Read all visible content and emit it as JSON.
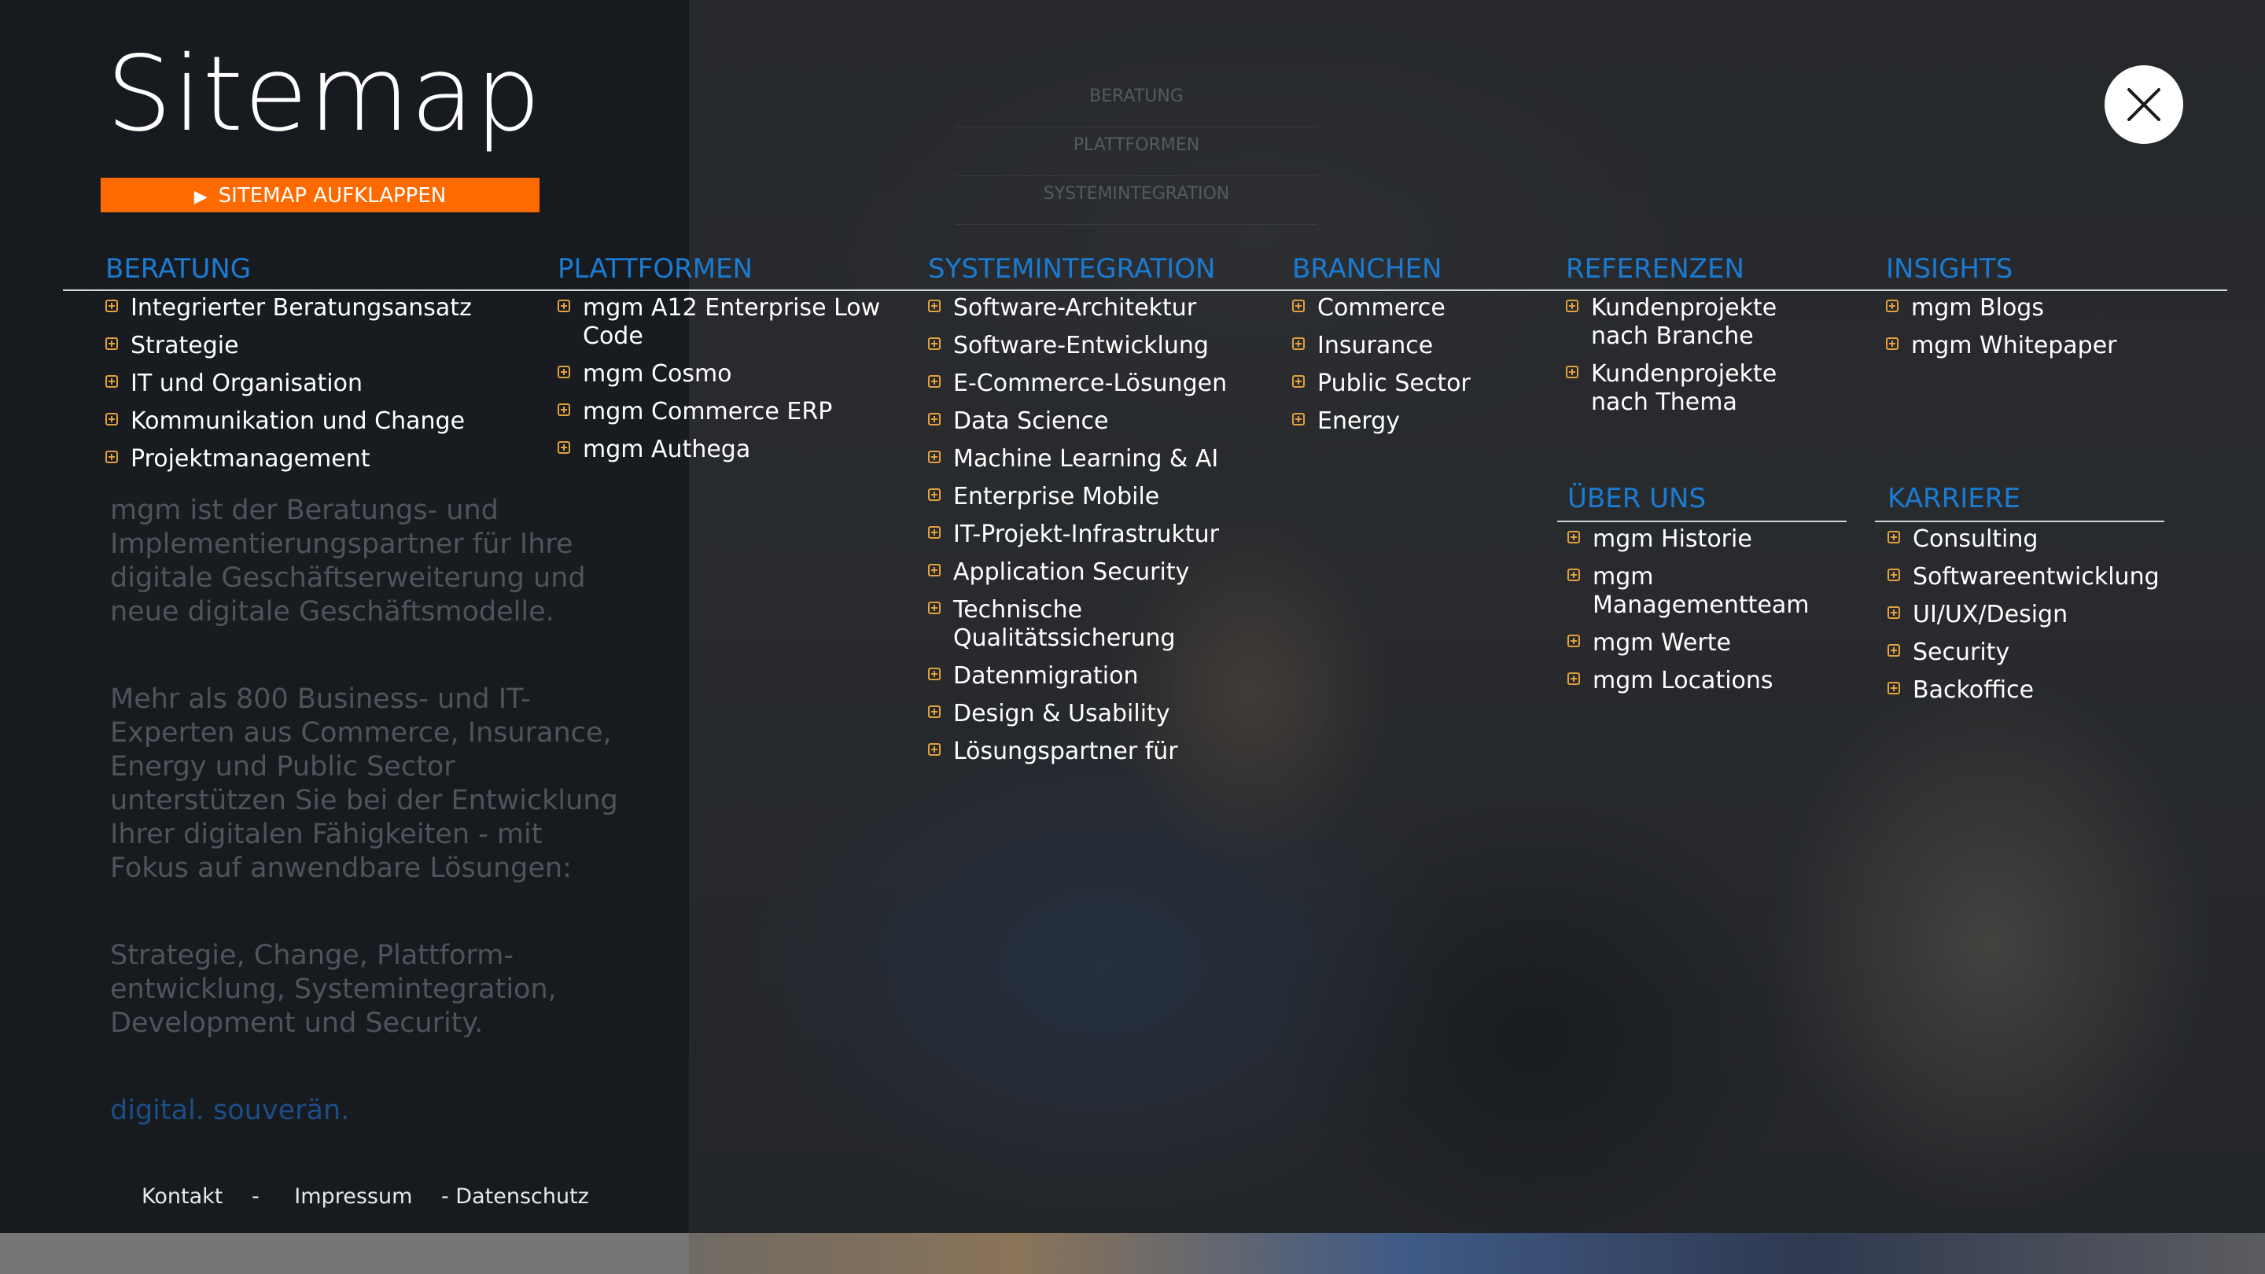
{
  "page": {
    "title": "Sitemap",
    "expand_label": "SITEMAP AUFKLAPPEN",
    "expand_icon": "play-triangle-icon",
    "accent_color": "#ff6a00",
    "heading_color": "#1b7bd1"
  },
  "ghost_nav": [
    "BERATUNG",
    "PLATTFORMEN",
    "SYSTEMINTEGRATION"
  ],
  "columns": {
    "beratung": {
      "title": "BERATUNG",
      "items": [
        "Integrierter Beratungsansatz",
        "Strategie",
        "IT und Organisation",
        "Kommunikation und Change",
        "Projektmanagement"
      ]
    },
    "plattformen": {
      "title": "PLATTFORMEN",
      "items": [
        "mgm A12 Enterprise Low Code",
        "mgm Cosmo",
        "mgm Commerce ERP",
        "mgm Authega"
      ]
    },
    "systemintegration": {
      "title": "SYSTEMINTEGRATION",
      "items": [
        "Software-Architektur",
        "Software-Entwicklung",
        "E-Commerce-Lösungen",
        "Data Science",
        "Machine Learning & AI",
        "Enterprise Mobile",
        "IT-Projekt-Infrastruktur",
        "Application Security",
        "Technische Qualitätssicherung",
        "Datenmigration",
        "Design & Usability",
        "Lösungspartner für"
      ]
    },
    "branchen": {
      "title": "BRANCHEN",
      "items": [
        "Commerce",
        "Insurance",
        "Public Sector",
        "Energy"
      ]
    },
    "referenzen": {
      "title": "REFERENZEN",
      "items": [
        "Kundenprojekte nach Branche",
        "Kundenprojekte nach Thema"
      ]
    },
    "insights": {
      "title": "INSIGHTS",
      "items": [
        "mgm Blogs",
        "mgm Whitepaper"
      ]
    },
    "ueber_uns": {
      "title": "ÜBER UNS",
      "items": [
        "mgm Historie",
        "mgm Managementteam",
        "mgm Werte",
        "mgm Locations"
      ]
    },
    "karriere": {
      "title": "KARRIERE",
      "items": [
        "Consulting",
        "Softwareentwicklung",
        "UI/UX/Design",
        "Security",
        "Backoffice"
      ]
    }
  },
  "intro": {
    "p1": "mgm ist der Beratungs- und Implementierungspartner für Ihre digitale Geschäftserweiterung und neue digitale Geschäftsmodelle.",
    "p2": "Mehr als 800 Business- und IT-Experten aus Commerce, Insurance, Energy und Public Sector unterstützen Sie bei der Entwicklung Ihrer digitalen Fähigkeiten - mit Fokus auf anwendbare Lösungen:",
    "p3": "Strategie, Change, Plattform-entwicklung, Systemintegration, Development und Security.",
    "p4": "digital. souverän."
  },
  "footer": {
    "kontakt": "Kontakt",
    "sep1": "-",
    "impressum": "Impressum",
    "datenschutz": "- Datenschutz"
  },
  "icons": {
    "close": "close-icon",
    "bullet": "plus-square-icon"
  }
}
